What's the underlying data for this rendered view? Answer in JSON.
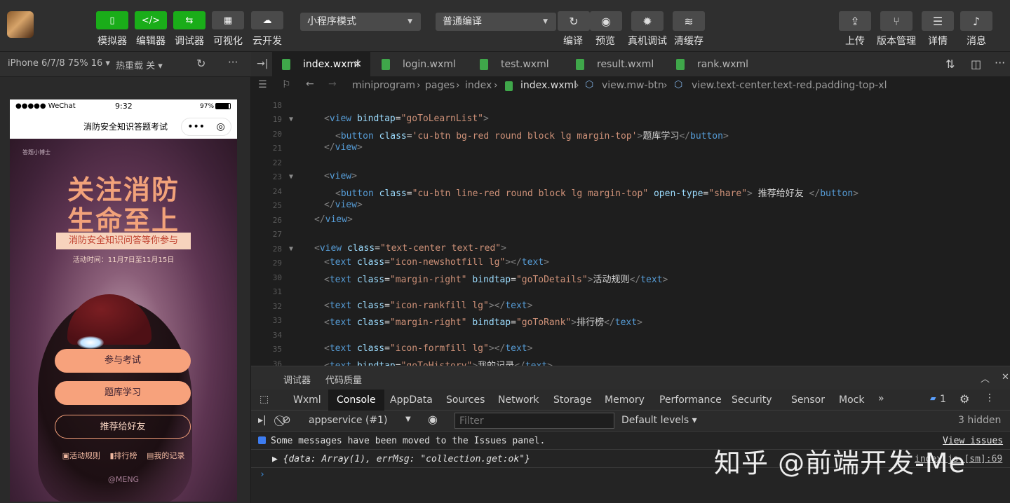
{
  "toolbar": {
    "left_buttons": [
      {
        "label": "模拟器",
        "icon": "phone-icon",
        "glyph": "▯"
      },
      {
        "label": "编辑器",
        "icon": "code-icon",
        "glyph": "</>"
      },
      {
        "label": "调试器",
        "icon": "debug-icon",
        "glyph": "⇆"
      },
      {
        "label": "可视化",
        "icon": "layout-icon",
        "glyph": "▦"
      },
      {
        "label": "云开发",
        "icon": "cloud-icon",
        "glyph": "☁"
      }
    ],
    "mode_select": "小程序模式",
    "compile_select": "普通编译",
    "actions": [
      {
        "label": "编译",
        "icon": "refresh-icon",
        "glyph": "↻"
      },
      {
        "label": "预览",
        "icon": "eye-icon",
        "glyph": "◉"
      },
      {
        "label": "真机调试",
        "icon": "bug-icon",
        "glyph": "✹"
      },
      {
        "label": "清缓存",
        "icon": "layers-icon",
        "glyph": "≋"
      }
    ],
    "right_actions": [
      {
        "label": "上传",
        "icon": "upload-icon",
        "glyph": "⇪"
      },
      {
        "label": "版本管理",
        "icon": "branch-icon",
        "glyph": "⑂"
      },
      {
        "label": "详情",
        "icon": "menu-icon",
        "glyph": "☰"
      },
      {
        "label": "消息",
        "icon": "bell-icon",
        "glyph": "♪"
      }
    ],
    "accent_green": "#1aad19"
  },
  "simulator": {
    "device": "iPhone 6/7/8 75% 16 ▾",
    "hot_reload": "热重载 关 ▾",
    "status": {
      "carrier": "●●●●● WeChat",
      "time": "9:32",
      "battery": "97%"
    },
    "nav_title": "消防安全知识答题考试",
    "capsule_more": "•••",
    "capsule_close": "◎",
    "poster": {
      "brand": "答题小博士",
      "headline1": "关注消防",
      "headline2": "生命至上",
      "subtitle": "消防安全知识问答等你参与",
      "date": "活动时间：11月7日至11月15日",
      "btn_exam": "参与考试",
      "btn_bank": "题库学习",
      "btn_share": "推荐给好友",
      "link_rules": "活动规则",
      "link_rank": "排行榜",
      "link_history": "我的记录",
      "watermark": "@MENG"
    }
  },
  "editor": {
    "tabs": [
      {
        "label": "index.wxml",
        "active": true
      },
      {
        "label": "login.wxml"
      },
      {
        "label": "test.wxml"
      },
      {
        "label": "result.wxml"
      },
      {
        "label": "rank.wxml"
      }
    ],
    "breadcrumb": [
      "miniprogram",
      "pages",
      "index",
      "index.wxml",
      "view.mw-btn",
      "view.text-center.text-red.padding-top-xl"
    ],
    "line_numbers": [
      "18",
      "19",
      "20",
      "21",
      "22",
      "23",
      "24",
      "25",
      "26",
      "27",
      "28",
      "29",
      "30",
      "31",
      "32",
      "33",
      "34",
      "35",
      "36"
    ]
  },
  "devtools": {
    "panel_tabs": [
      "调试器",
      "代码质量"
    ],
    "tabs": [
      "Wxml",
      "Console",
      "AppData",
      "Sources",
      "Network",
      "Storage",
      "Memory",
      "Performance",
      "Security",
      "Sensor",
      "Mock"
    ],
    "more": "»",
    "issues_count": "1",
    "context": "appservice (#1)",
    "filter_placeholder": "Filter",
    "levels": "Default levels ▾",
    "hidden": "3 hidden",
    "messages": [
      {
        "text": "Some messages have been moved to the Issues panel.",
        "link": "View issues"
      },
      {
        "text": "▶ {data: Array(1), errMsg: \"collection.get:ok\"}",
        "source": "index.js [sm]:69"
      }
    ],
    "prompt": "›"
  },
  "watermark": "知乎 @前端开发-Me"
}
